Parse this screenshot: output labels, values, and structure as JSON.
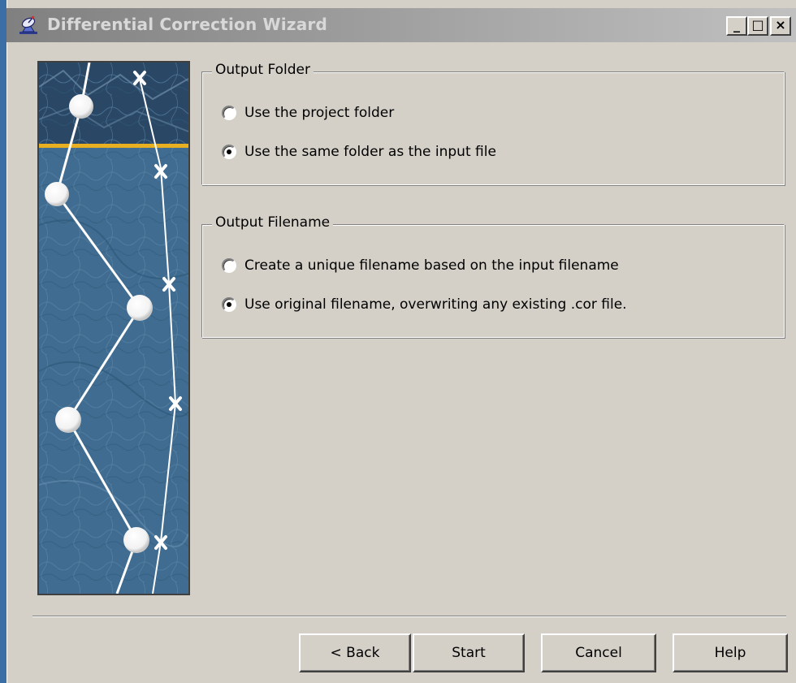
{
  "window": {
    "title": "Differential Correction Wizard",
    "caption_buttons": {
      "minimize": "_",
      "maximize": "□",
      "close": "×"
    }
  },
  "output_folder": {
    "legend": "Output Folder",
    "options": [
      {
        "label": "Use the project folder",
        "checked": false
      },
      {
        "label": "Use the same folder as the input file",
        "checked": true
      }
    ]
  },
  "output_filename": {
    "legend": "Output Filename",
    "options": [
      {
        "label": "Create a unique filename based on the input filename",
        "checked": false
      },
      {
        "label": "Use original filename, overwriting any existing .cor file.",
        "checked": true
      }
    ]
  },
  "buttons": {
    "back": "< Back",
    "start": "Start",
    "cancel": "Cancel",
    "help": "Help"
  },
  "colors": {
    "titlebar_inactive": "#808080",
    "dialog_face": "#d4d0c8",
    "banner_blue": "#3c6a8e",
    "banner_accent": "#e8b020"
  },
  "icons": {
    "title_icon": "satellite-dish-icon",
    "banner": "gps-track-map-banner"
  }
}
